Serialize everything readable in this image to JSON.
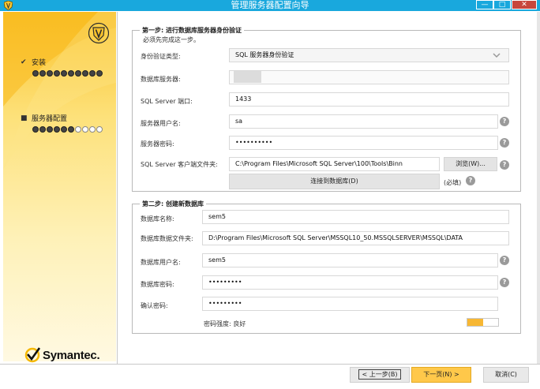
{
  "window": {
    "title": "管理服务器配置向导",
    "controls": {
      "minimize": "—",
      "maximize": "□",
      "close": "✕"
    }
  },
  "sidebar": {
    "steps": [
      {
        "label": "安装",
        "mark": "✔",
        "dots_filled": 10,
        "dots_total": 10
      },
      {
        "label": "服务器配置",
        "mark": "■",
        "dots_filled": 6,
        "dots_total": 10
      }
    ],
    "brand": "Symantec."
  },
  "step1": {
    "title": "第一步: 进行数据库服务器身份验证",
    "subtitle": "必须先完成这一步。",
    "auth_label": "身份验证类型:",
    "auth_value": "SQL 服务器身份验证",
    "db_server_label": "数据库服务器:",
    "db_server_value": "",
    "port_label": "SQL Server 端口:",
    "port_value": "1433",
    "user_label": "服务器用户名:",
    "user_value": "sa",
    "password_label": "服务器密码:",
    "password_value": "••••••••••",
    "client_folder_label": "SQL Server 客户端文件夹:",
    "client_folder_value": "C:\\Program Files\\Microsoft SQL Server\\100\\Tools\\Binn",
    "browse_button": "浏览(W)...",
    "connect_button": "连接到数据库(D)",
    "required_note": "(必填)",
    "help": "?"
  },
  "step2": {
    "title": "第二步: 创建新数据库",
    "db_name_label": "数据库名称:",
    "db_name_value": "sem5",
    "db_folder_label": "数据库数据文件夹:",
    "db_folder_value": "D:\\Program Files\\Microsoft SQL Server\\MSSQL10_50.MSSQLSERVER\\MSSQL\\DATA",
    "db_user_label": "数据库用户名:",
    "db_user_value": "sem5",
    "db_password_label": "数据库密码:",
    "db_password_value": "•••••••••",
    "confirm_label": "确认密码:",
    "confirm_value": "•••••••••",
    "strength_label": "密码强度: 良好",
    "strength_fraction": 0.5
  },
  "footer": {
    "back_button": "< 上一步(B)",
    "next_button": "下一页(N) >",
    "cancel_button": "取消(C)"
  },
  "colors": {
    "titlebar": "#19a8dd",
    "close": "#c7463d",
    "accent": "#fbc22a",
    "next_button": "#ffc84a"
  }
}
